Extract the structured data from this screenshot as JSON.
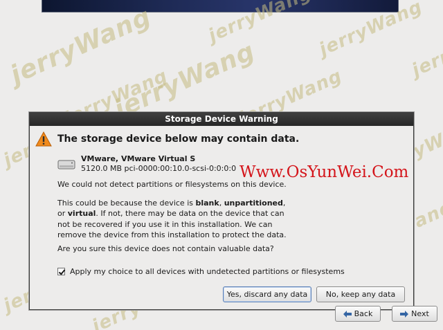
{
  "dialog": {
    "title": "Storage Device Warning",
    "headline": "The storage device below may contain data.",
    "device_name": "VMware, VMware Virtual S",
    "device_info": "5120.0 MB pci-0000:00:10.0-scsi-0:0:0:0",
    "line_no_partitions": "We could not detect partitions or filesystems on this device.",
    "para_1": "This could be because the device is ",
    "para_blank": "blank",
    "para_sep1": ", ",
    "para_unpartitioned": "unpartitioned",
    "para_sep2": ",",
    "para_or": "or ",
    "para_virtual": "virtual",
    "para_rest": ". If not, there may be data on the device that can not be recovered if you use it in this installation. We can remove the device from this installation to protect the data.",
    "question": "Are you sure this device does not contain valuable data?",
    "apply_all_label": "Apply my choice to all devices with undetected partitions or filesystems",
    "apply_all_checked": true,
    "yes_button": "Yes, discard any data",
    "no_button": "No, keep any data"
  },
  "navigation": {
    "back_label": "Back",
    "next_label": "Next"
  },
  "watermark": {
    "text": "jerryWang",
    "site": "Www.OsYunWei.Com"
  },
  "colors": {
    "titlebar": "#333333",
    "warning_icon": "#f08a1c",
    "site_mark": "#d4151b",
    "watermark": "#c4bc82"
  }
}
